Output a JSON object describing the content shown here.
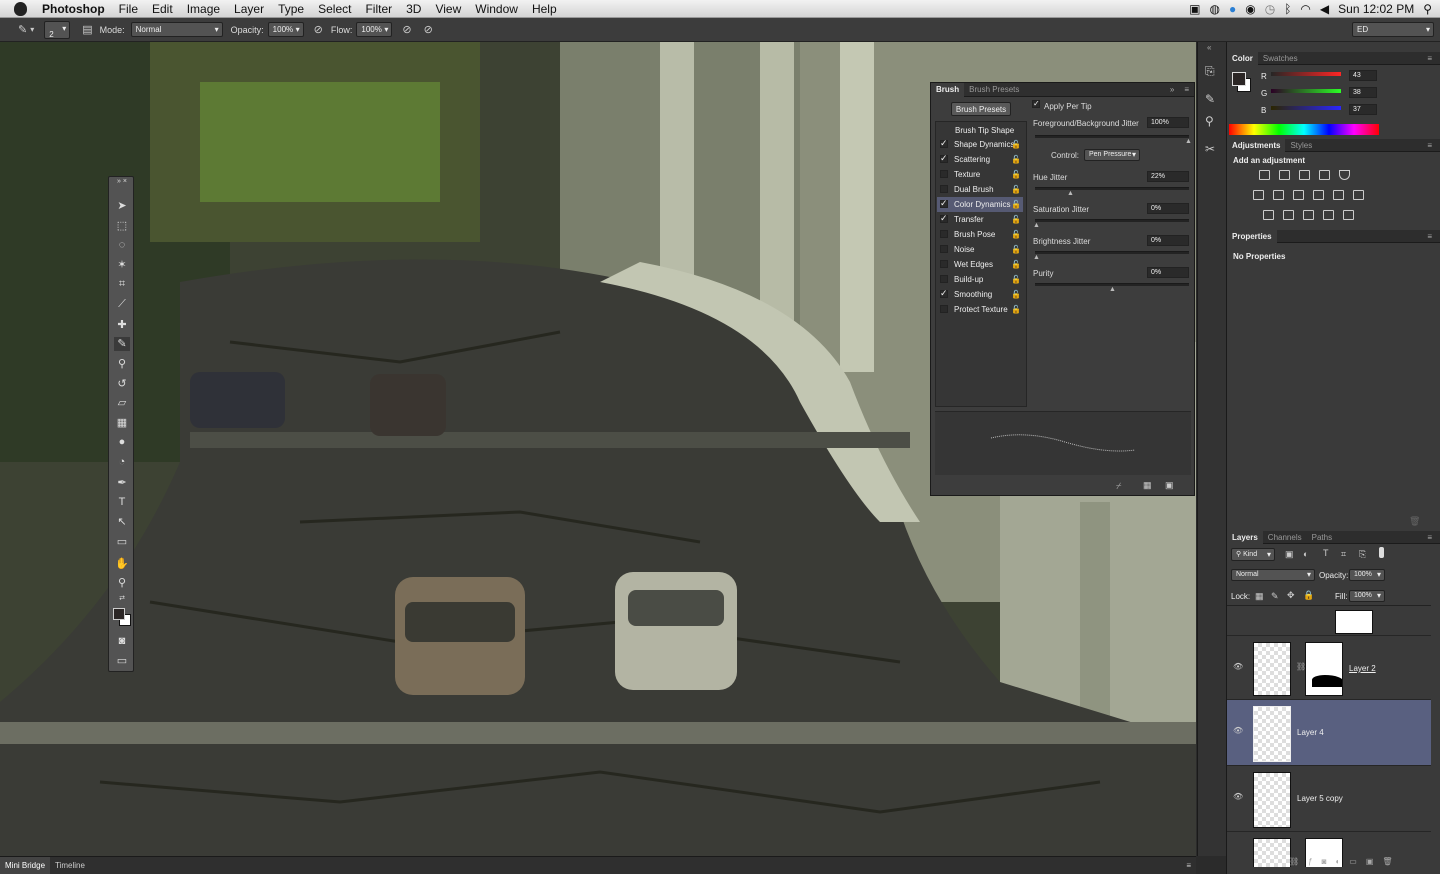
{
  "menubar": {
    "app": "Photoshop",
    "items": [
      "File",
      "Edit",
      "Image",
      "Layer",
      "Type",
      "Select",
      "Filter",
      "3D",
      "View",
      "Window",
      "Help"
    ],
    "clock": "Sun 12:02 PM"
  },
  "options": {
    "brush_size": "2",
    "mode_label": "Mode:",
    "mode_value": "Normal",
    "opacity_label": "Opacity:",
    "opacity_value": "100%",
    "flow_label": "Flow:",
    "flow_value": "100%",
    "workspace": "ED"
  },
  "brush_panel": {
    "tabs": [
      "Brush",
      "Brush Presets"
    ],
    "presets_button": "Brush Presets",
    "tip_shape": "Brush Tip Shape",
    "items": [
      {
        "label": "Shape Dynamics",
        "checked": true
      },
      {
        "label": "Scattering",
        "checked": true
      },
      {
        "label": "Texture",
        "checked": false
      },
      {
        "label": "Dual Brush",
        "checked": false
      },
      {
        "label": "Color Dynamics",
        "checked": true
      },
      {
        "label": "Transfer",
        "checked": true
      },
      {
        "label": "Brush Pose",
        "checked": false
      },
      {
        "label": "Noise",
        "checked": false
      },
      {
        "label": "Wet Edges",
        "checked": false
      },
      {
        "label": "Build-up",
        "checked": false
      },
      {
        "label": "Smoothing",
        "checked": true
      },
      {
        "label": "Protect Texture",
        "checked": false
      }
    ],
    "apply_per_tip": "Apply Per Tip",
    "fg_bg_jitter_label": "Foreground/Background Jitter",
    "fg_bg_jitter_value": "100%",
    "control_label": "Control:",
    "control_value": "Pen Pressure",
    "hue_jitter_label": "Hue Jitter",
    "hue_jitter_value": "22%",
    "saturation_jitter_label": "Saturation Jitter",
    "saturation_jitter_value": "0%",
    "brightness_jitter_label": "Brightness Jitter",
    "brightness_jitter_value": "0%",
    "purity_label": "Purity",
    "purity_value": "0%"
  },
  "color_panel": {
    "tabs": [
      "Color",
      "Swatches"
    ],
    "r_label": "R",
    "r_value": "43",
    "g_label": "G",
    "g_value": "38",
    "b_label": "B",
    "b_value": "37",
    "foreground": "#2b2625",
    "background": "#ffffff"
  },
  "adjustments_panel": {
    "tabs": [
      "Adjustments",
      "Styles"
    ],
    "title": "Add an adjustment"
  },
  "properties_panel": {
    "title": "Properties",
    "empty": "No Properties"
  },
  "layers_panel": {
    "tabs": [
      "Layers",
      "Channels",
      "Paths"
    ],
    "kind": "Kind",
    "blend_mode": "Normal",
    "opacity_label": "Opacity:",
    "opacity_value": "100%",
    "lock_label": "Lock:",
    "fill_label": "Fill:",
    "fill_value": "100%",
    "layers": [
      {
        "name": "Layer 2",
        "selected": false
      },
      {
        "name": "Layer 4",
        "selected": true
      },
      {
        "name": "Layer 5 copy",
        "selected": false
      }
    ]
  },
  "bottom_tabs": [
    "Mini Bridge",
    "Timeline"
  ]
}
